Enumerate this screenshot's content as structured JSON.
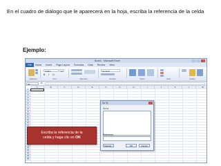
{
  "heading": "En el cuadro de diálogo que le aparecerá en la hoja, escriba la referencia de la celda",
  "example_label": "Ejemplo:",
  "excel": {
    "window_title": "Book1 - Microsoft Excel",
    "file_tab": "File",
    "tabs": [
      "Home",
      "Insert",
      "Page Layout",
      "Formulas",
      "Data",
      "Review",
      "View"
    ],
    "font_name": "Calibri",
    "font_size": "11",
    "format_buttons": "B I U",
    "number_format": "General",
    "groups": [
      "Clipboard",
      "Font",
      "Alignment",
      "Number",
      "Styles",
      "Cells",
      "Editing"
    ],
    "name_box": "A1",
    "fx_label": "fx",
    "columns": [
      "A",
      "B",
      "C",
      "D",
      "E",
      "F",
      "G",
      "H",
      "I",
      "J",
      "K",
      "L",
      "M"
    ],
    "rows": [
      "1",
      "2",
      "3",
      "4",
      "5",
      "6",
      "7",
      "8",
      "9",
      "10",
      "11",
      "12",
      "13",
      "14",
      "15",
      "16",
      "17",
      "18",
      "19",
      "20",
      "21",
      "22",
      "23",
      "24",
      "25",
      "26"
    ]
  },
  "dialog": {
    "title": "Go To",
    "go_to_label": "Go to:",
    "reference_label": "Reference:",
    "special_button": "Special...",
    "ok_button": "OK",
    "cancel_button": "Cancel"
  },
  "callout": {
    "line1": "Escriba la referencia de la",
    "line2_prefix": "celda y haga clic en ",
    "line2_bold": "OK"
  },
  "colors": {
    "callout_bg": "#a8322d",
    "file_tab": "#2f66b3"
  }
}
